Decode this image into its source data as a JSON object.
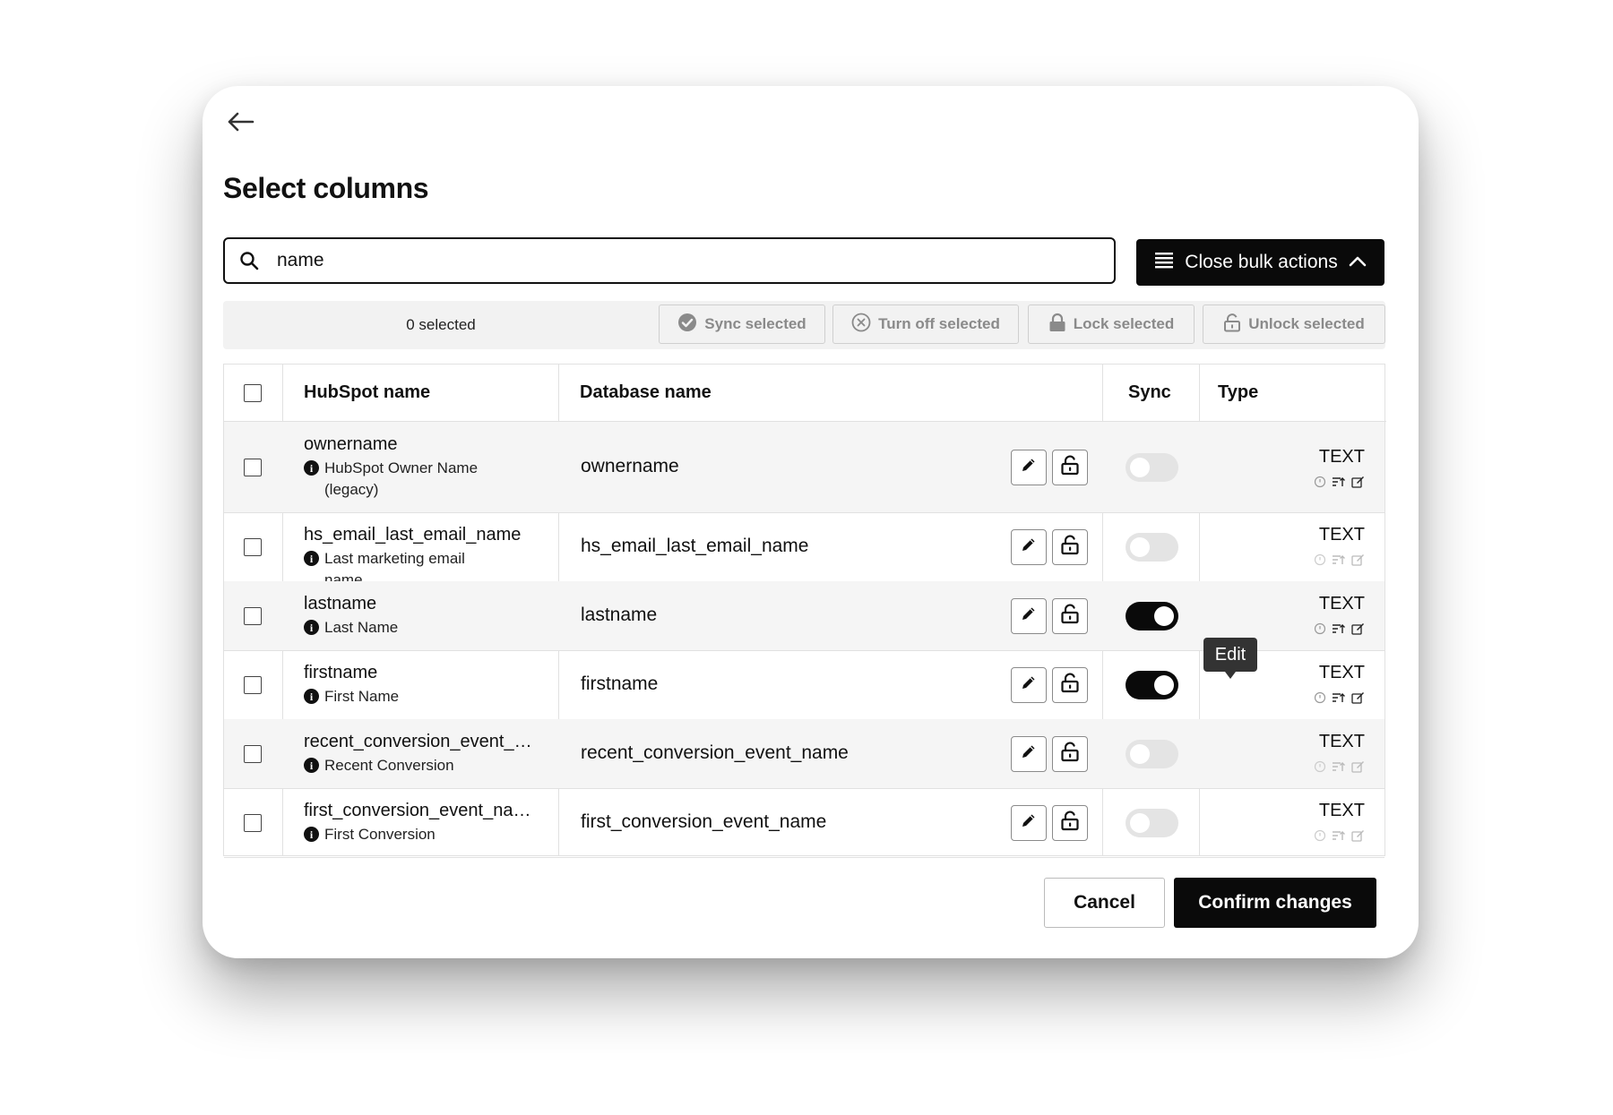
{
  "dialog": {
    "title": "Select columns",
    "back_icon": "arrow-left-icon"
  },
  "search": {
    "value": "name",
    "icon": "search-icon"
  },
  "bulk_toggle": {
    "label": "Close bulk actions",
    "icon": "list-icon",
    "chevron": "chevron-up-icon"
  },
  "bulk_actions": {
    "selected_count": "0 selected",
    "sync_label": "Sync selected",
    "turn_off_label": "Turn off selected",
    "lock_label": "Lock selected",
    "unlock_label": "Unlock selected"
  },
  "table": {
    "headers": {
      "hubspot": "HubSpot name",
      "database": "Database name",
      "sync": "Sync",
      "type": "Type"
    },
    "rows": [
      {
        "hubspot_name": "ownername",
        "label": "HubSpot Owner Name (legacy)",
        "db_name": "ownername",
        "sync": false,
        "type": "TEXT",
        "type_icons_active": true
      },
      {
        "hubspot_name": "hs_email_last_email_name",
        "label": "Last marketing email name",
        "db_name": "hs_email_last_email_name",
        "sync": false,
        "type": "TEXT",
        "type_icons_active": false
      },
      {
        "hubspot_name": "lastname",
        "label": "Last Name",
        "db_name": "lastname",
        "sync": true,
        "type": "TEXT",
        "type_icons_active": true
      },
      {
        "hubspot_name": "firstname",
        "label": "First Name",
        "db_name": "firstname",
        "sync": true,
        "type": "TEXT",
        "type_icons_active": true
      },
      {
        "hubspot_name": "recent_conversion_event_…",
        "label": "Recent Conversion",
        "db_name": "recent_conversion_event_name",
        "sync": false,
        "type": "TEXT",
        "type_icons_active": false
      },
      {
        "hubspot_name": "first_conversion_event_na…",
        "label": "First Conversion",
        "db_name": "first_conversion_event_name",
        "sync": false,
        "type": "TEXT",
        "type_icons_active": false
      }
    ]
  },
  "tooltip": {
    "label": "Edit"
  },
  "footer": {
    "cancel_label": "Cancel",
    "confirm_label": "Confirm changes"
  },
  "colors": {
    "primary": "#0a0a0a",
    "muted": "#8a8a8a",
    "row_alt": "#f5f5f5",
    "toggle_off": "#e4e4e4"
  }
}
